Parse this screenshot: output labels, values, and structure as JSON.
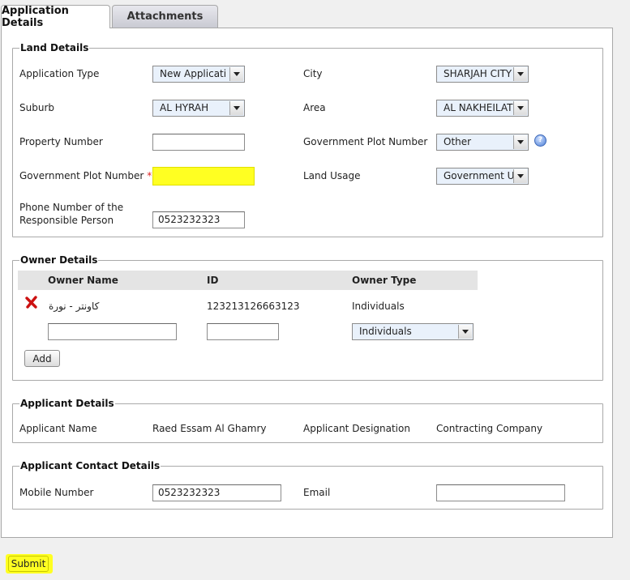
{
  "tabs": [
    {
      "label": "Application Details",
      "active": true
    },
    {
      "label": "Attachments",
      "active": false
    }
  ],
  "land_details": {
    "legend": "Land Details",
    "application_type": {
      "label": "Application Type",
      "value": "New Applicati"
    },
    "city": {
      "label": "City",
      "value": "SHARJAH CITY"
    },
    "suburb": {
      "label": "Suburb",
      "value": "AL HYRAH"
    },
    "area": {
      "label": "Area",
      "value": "AL NAKHEILAT"
    },
    "property_number": {
      "label": "Property Number",
      "value": ""
    },
    "gov_plot_number_select": {
      "label": "Government Plot Number",
      "value": "Other",
      "help": "?"
    },
    "gov_plot_number_input": {
      "label": "Government Plot Number",
      "required_mark": "*",
      "value": ""
    },
    "land_usage": {
      "label": "Land Usage",
      "value": "Government U"
    },
    "phone": {
      "label": "Phone Number of the Responsible Person",
      "value": "0523232323"
    }
  },
  "owner_details": {
    "legend": "Owner Details",
    "columns": [
      "Owner Name",
      "ID",
      "Owner Type"
    ],
    "rows": [
      {
        "name": "كاونتر - نورة",
        "id": "123213126663123",
        "type": "Individuals"
      }
    ],
    "new_row": {
      "name": "",
      "id": "",
      "type": "Individuals"
    },
    "add_label": "Add"
  },
  "applicant_details": {
    "legend": "Applicant Details",
    "name_label": "Applicant Name",
    "name_value": "Raed Essam Al Ghamry",
    "designation_label": "Applicant Designation",
    "designation_value": "Contracting Company"
  },
  "contact_details": {
    "legend": "Applicant Contact Details",
    "mobile_label": "Mobile Number",
    "mobile_value": "0523232323",
    "email_label": "Email",
    "email_value": ""
  },
  "submit_label": "Submit",
  "colors": {
    "highlight": "#ffff22",
    "select_bg": "#e9f1fb",
    "required": "#dd2222",
    "delete": "#cc1111"
  },
  "icons": {
    "delete": "red-x-icon",
    "help": "question-help-icon",
    "dropdown": "chevron-down-icon"
  }
}
